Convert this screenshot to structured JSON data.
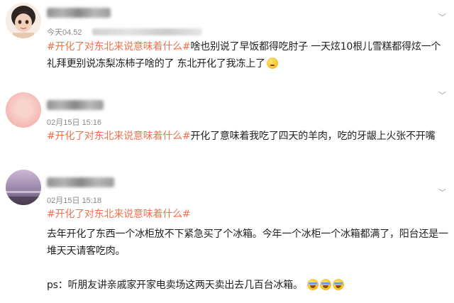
{
  "posts": [
    {
      "time": "今天04.52",
      "tag": "#开化了对东北来说意味着什么#",
      "body": "啥也别说了早饭都得吃肘子 一天炫10根儿雪糕都得炫一个礼拜更别说冻梨冻柿子啥的了 东北开化了我冻上了",
      "emoji": [
        "thinking-face-icon"
      ]
    },
    {
      "time": "02月15日 15:16",
      "tag": "#开化了对东北来说意味着什么#",
      "body": "开化了意味着我吃了四天的羊肉，吃的牙龈上火张不开嘴",
      "emoji": []
    },
    {
      "time": "02月15日 15:18",
      "tag": "#开化了对东北来说意味着什么#",
      "body": "去年开化了东西一个冰柜放不下紧急买了个冰箱。今年一个冰柜一个冰箱都满了，阳台还是一堆天天请客吃肉。",
      "ps": "ps：听朋友讲亲戚家开家电卖场这两天卖出去几百台冰箱。",
      "emoji": [
        "laughing-tears-icon",
        "laughing-tears-icon",
        "laughing-tears-icon"
      ]
    }
  ],
  "colors": {
    "tag": "#eb7350",
    "meta": "#8a8a8a",
    "text": "#1f1f1f"
  }
}
